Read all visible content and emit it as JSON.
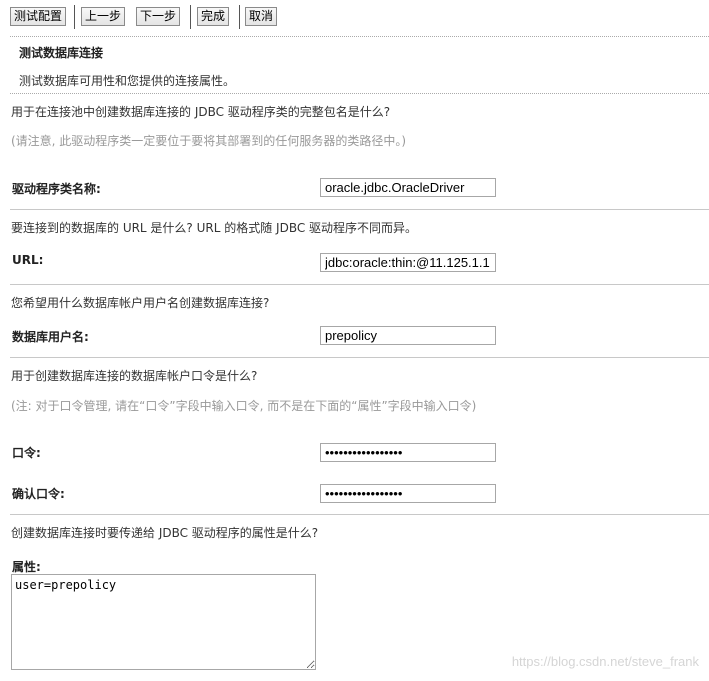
{
  "toolbar": {
    "test_config": "测试配置",
    "prev": "上一步",
    "next": "下一步",
    "finish": "完成",
    "cancel": "取消"
  },
  "section": {
    "title": "测试数据库连接",
    "description": "测试数据库可用性和您提供的连接属性。"
  },
  "driver": {
    "question": "用于在连接池中创建数据库连接的 JDBC 驱动程序类的完整包名是什么?",
    "note": "(请注意, 此驱动程序类一定要位于要将其部署到的任何服务器的类路径中。)",
    "label": "驱动程序类名称:",
    "value": "oracle.jdbc.OracleDriver"
  },
  "url": {
    "question": "要连接到的数据库的 URL 是什么? URL 的格式随 JDBC 驱动程序不同而异。",
    "label": "URL:",
    "value": "jdbc:oracle:thin:@11.125.1.1"
  },
  "user": {
    "question": "您希望用什么数据库帐户用户名创建数据库连接?",
    "label": "数据库用户名:",
    "value": "prepolicy"
  },
  "password": {
    "question": "用于创建数据库连接的数据库帐户口令是什么?",
    "note": "(注: 对于口令管理, 请在“口令”字段中输入口令, 而不是在下面的“属性”字段中输入口令)",
    "label": "口令:",
    "value": "•••••••••••••••••",
    "confirm_label": "确认口令:",
    "confirm_value": "•••••••••••••••••"
  },
  "properties": {
    "question": "创建数据库连接时要传递给 JDBC 驱动程序的属性是什么?",
    "label": "属性:",
    "value": "user=prepolicy"
  },
  "watermark": "https://blog.csdn.net/steve_frank"
}
